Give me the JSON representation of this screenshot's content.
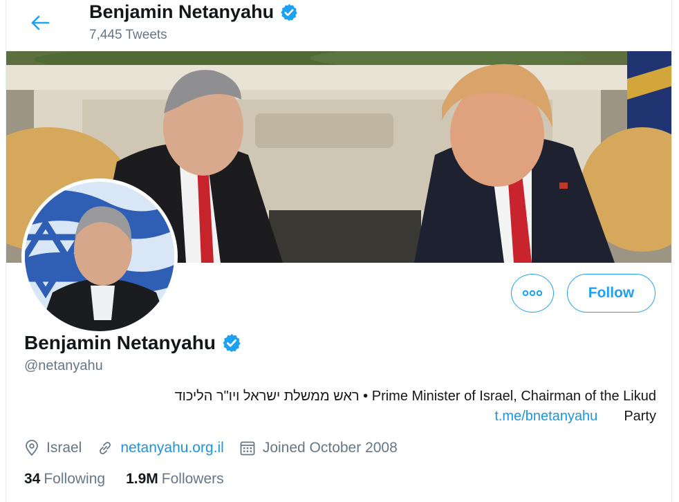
{
  "header": {
    "title": "Benjamin Netanyahu",
    "tweet_count": "7,445 Tweets"
  },
  "profile": {
    "name": "Benjamin Netanyahu",
    "handle": "@netanyahu",
    "bio_line1": "ראש ממשלת ישראל ויו\"ר הליכוד • Prime Minister of Israel, Chairman of the Likud",
    "bio_link": "t.me/bnetanyahu",
    "bio_party": "Party",
    "location": "Israel",
    "website": "netanyahu.org.il",
    "joined": "Joined October 2008"
  },
  "stats": {
    "following_count": "34",
    "following_label": "Following",
    "followers_count": "1.9M",
    "followers_label": "Followers"
  },
  "actions": {
    "follow_label": "Follow"
  },
  "icons": {
    "back": "arrow-left-icon",
    "verified": "verified-badge-icon",
    "more": "more-options-icon",
    "location": "location-pin-icon",
    "link": "link-icon",
    "calendar": "calendar-icon"
  },
  "colors": {
    "accent": "#1da1f2",
    "link": "#1b95e0",
    "muted": "#657786",
    "text": "#14171a"
  }
}
